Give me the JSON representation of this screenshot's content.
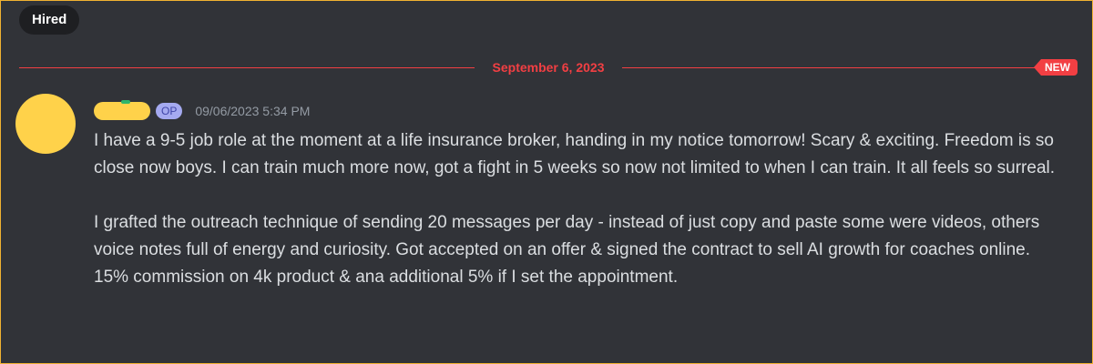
{
  "tag": {
    "label": "Hired"
  },
  "divider": {
    "date": "September 6, 2023",
    "new_badge": "NEW"
  },
  "message": {
    "author_badge": "OP",
    "timestamp": "09/06/2023 5:34 PM",
    "paragraphs": [
      "I have a 9-5 job role at the moment at a life insurance broker, handing in my notice tomorrow! Scary & exciting. Freedom is so close now boys. I can train much more now, got a fight in 5 weeks so now not limited to when I can train. It all feels so surreal.",
      "I grafted the outreach technique of sending 20 messages per day - instead of just copy and paste some were videos, others voice notes full of energy and curiosity. Got accepted on an offer & signed the contract to sell AI growth for coaches online. 15% commission on 4k product & ana additional 5% if I set the appointment."
    ]
  },
  "colors": {
    "background": "#313338",
    "accent_red": "#f23f43",
    "text": "#dbdee1",
    "muted": "#949ba4",
    "redaction": "#ffd24a"
  }
}
